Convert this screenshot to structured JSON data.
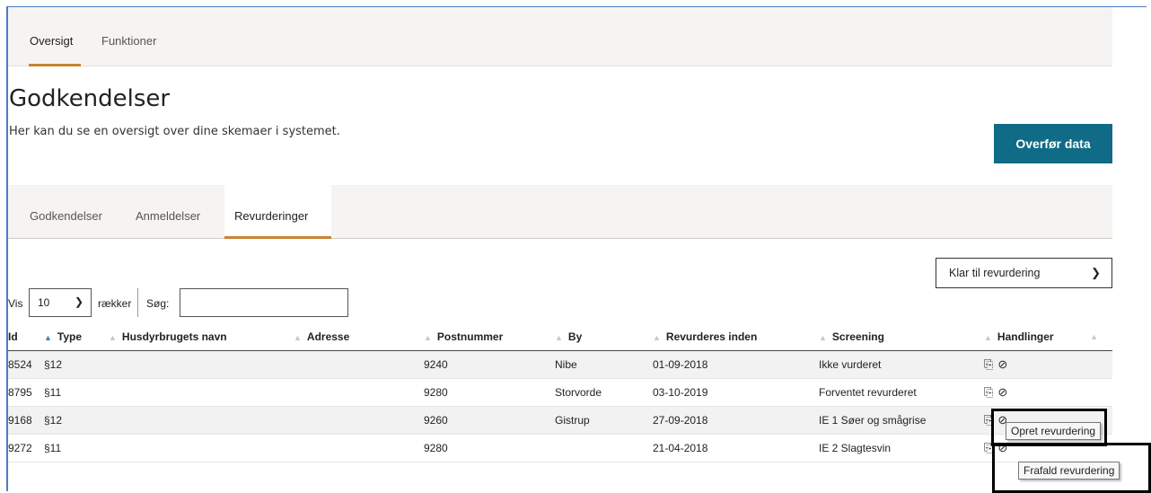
{
  "topnav": {
    "tabs": [
      {
        "label": "Oversigt"
      },
      {
        "label": "Funktioner"
      }
    ]
  },
  "page": {
    "title": "Godkendelser",
    "description": "Her kan du se en oversigt over dine skemaer i systemet.",
    "transfer_button": "Overfør data"
  },
  "subnav": {
    "tabs": [
      {
        "label": "Godkendelser"
      },
      {
        "label": "Anmeldelser"
      },
      {
        "label": "Revurderinger"
      }
    ]
  },
  "filter": {
    "selected": "Klar til revurdering"
  },
  "length": {
    "vis_label": "Vis",
    "value": "10",
    "rows_label": "rækker",
    "search_label": "Søg:"
  },
  "table": {
    "columns": [
      "Id",
      "Type",
      "Husdyrbrugets navn",
      "Adresse",
      "Postnummer",
      "By",
      "Revurderes inden",
      "Screening",
      "Handlinger"
    ],
    "rows": [
      {
        "id": "8524",
        "type": "§12",
        "name": "",
        "address": "",
        "postnr": "9240",
        "city": "Nibe",
        "date": "01-09-2018",
        "screening": "Ikke vurderet"
      },
      {
        "id": "8795",
        "type": "§11",
        "name": "",
        "address": "",
        "postnr": "9280",
        "city": "Storvorde",
        "date": "03-10-2019",
        "screening": "Forventet revurderet"
      },
      {
        "id": "9168",
        "type": "§12",
        "name": "",
        "address": "",
        "postnr": "9260",
        "city": "Gistrup",
        "date": "27-09-2018",
        "screening": "IE 1 Søer og smågrise"
      },
      {
        "id": "9272",
        "type": "§11",
        "name": "",
        "address": "",
        "postnr": "9280",
        "city": "",
        "date": "21-04-2018",
        "screening": "IE 2 Slagtesvin"
      }
    ]
  },
  "tooltips": {
    "create": "Opret revurdering",
    "cancel": "Frafald revurdering"
  },
  "colors": {
    "accent": "#c98434",
    "primary_button": "#0f6b86",
    "frame": "#4a7dc1"
  },
  "icons": {
    "copy": "copy-icon",
    "cancel": "ban-icon"
  }
}
